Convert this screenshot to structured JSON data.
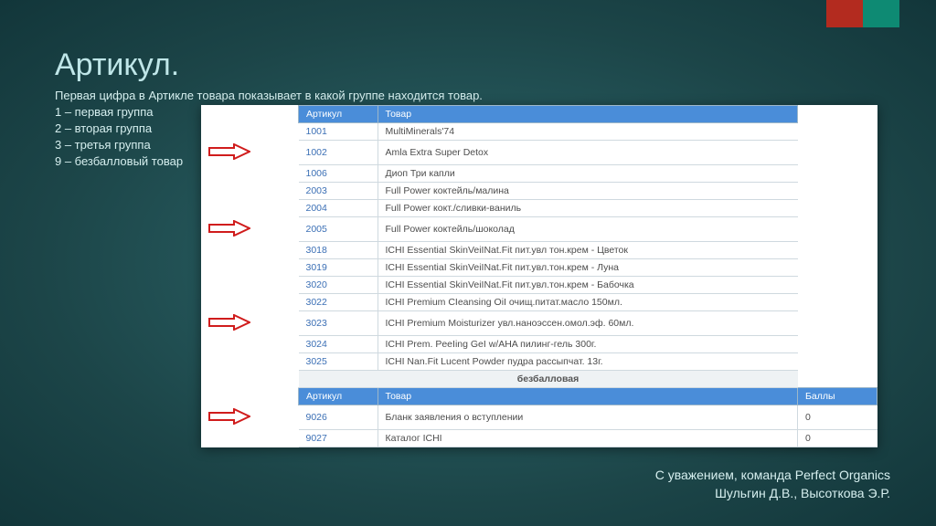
{
  "title": "Артикул.",
  "subtitle": "Первая цифра в Артикле товара показывает в какой группе находится товар.",
  "bullets": [
    "1 – первая группа",
    "2 – вторая группа",
    "3 – третья группа",
    "9 – безбалловый товар"
  ],
  "table": {
    "headers": {
      "art": "Артикул",
      "name": "Товар",
      "points": "Баллы"
    },
    "subhead": "безбалловая",
    "rows": [
      {
        "arrow": false,
        "art": "1001",
        "name": "MultiMinerals'74"
      },
      {
        "arrow": true,
        "art": "1002",
        "name": "Amla Extra Super Detox"
      },
      {
        "arrow": false,
        "art": "1006",
        "name": "Диоп Три капли"
      },
      {
        "arrow": false,
        "art": "2003",
        "name": "Full Power коктейль/малина"
      },
      {
        "arrow": false,
        "art": "2004",
        "name": "Full Power кокт./сливки-ваниль"
      },
      {
        "arrow": true,
        "art": "2005",
        "name": "Full Power коктейль/шоколад"
      },
      {
        "arrow": false,
        "art": "3018",
        "name": "ICHI EssentiaI SkinVeiINat.Fit пит.увл тон.крем - Цветок"
      },
      {
        "arrow": false,
        "art": "3019",
        "name": "ICHI EssentiaI SkinVeiINat.Fit пит.увл.тон.крем - Луна"
      },
      {
        "arrow": false,
        "art": "3020",
        "name": "ICHI EssentiaI SkinVeiINat.Fit пит.увл.тон.крем - Бабочка"
      },
      {
        "arrow": false,
        "art": "3022",
        "name": "ICHI Premium CIeansing OiI очищ.питат.масло 150мл."
      },
      {
        "arrow": true,
        "art": "3023",
        "name": "ICHI Premium Moisturizer увл.наноэссен.омол.эф. 60мл."
      },
      {
        "arrow": false,
        "art": "3024",
        "name": "ICHI Prem. PeeIing GeI w/AHA пилинг-гель 300г."
      },
      {
        "arrow": false,
        "art": "3025",
        "name": "ICHI Nan.Fit Lucent Powder пудра рассыпчат. 13г."
      }
    ],
    "rows2": [
      {
        "arrow": true,
        "art": "9026",
        "name": "Бланк заявления о вступлении",
        "points": "0"
      },
      {
        "arrow": false,
        "art": "9027",
        "name": "Каталог ICHI",
        "points": "0"
      }
    ]
  },
  "footer": {
    "line1": "С уважением, команда Perfect Organics",
    "line2": "Шульгин Д.В., Высоткова Э.Р."
  }
}
